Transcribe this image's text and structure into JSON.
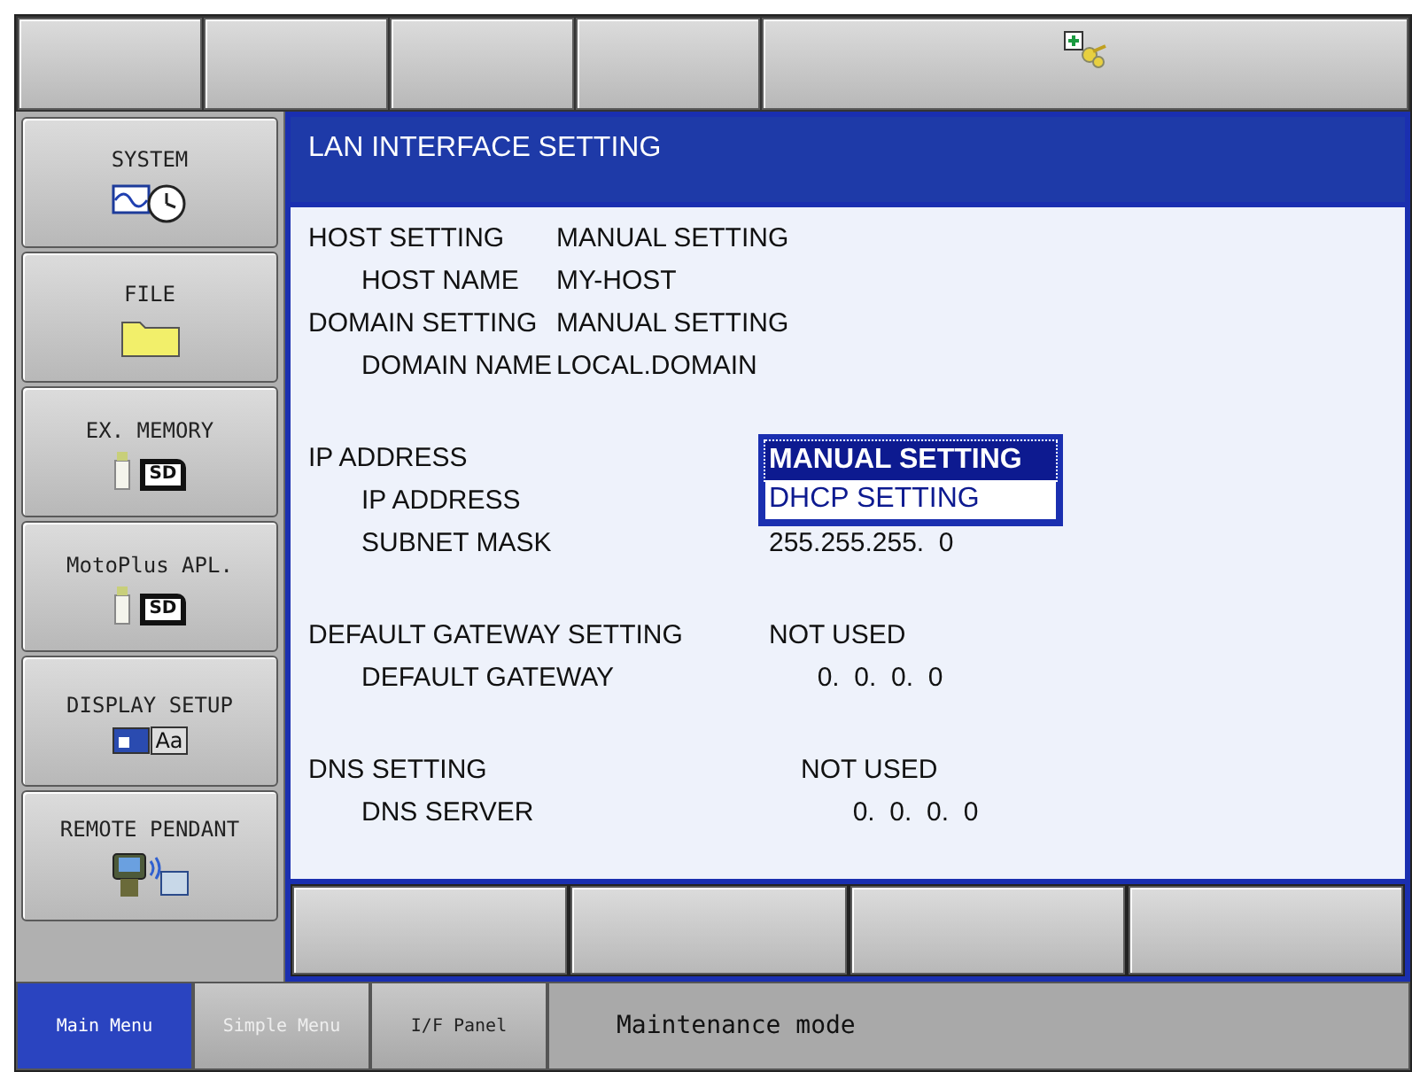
{
  "side_menu": [
    {
      "label": "SYSTEM",
      "kind": "system"
    },
    {
      "label": "FILE",
      "kind": "file"
    },
    {
      "label": "EX. MEMORY",
      "kind": "memory",
      "icon_text": "SD"
    },
    {
      "label": "MotoPlus APL.",
      "kind": "memory",
      "icon_text": "SD"
    },
    {
      "label": "DISPLAY SETUP",
      "kind": "display",
      "icon_text": "Aa"
    },
    {
      "label": "REMOTE PENDANT",
      "kind": "pendant"
    }
  ],
  "panel": {
    "title": "LAN INTERFACE SETTING",
    "sections": [
      {
        "items": [
          {
            "label": "HOST SETTING",
            "value": "MANUAL SETTING",
            "children": [
              {
                "label": "HOST NAME",
                "value": "MY-HOST"
              }
            ]
          },
          {
            "label": "DOMAIN SETTING",
            "value": "MANUAL SETTING",
            "children": [
              {
                "label": "DOMAIN NAME",
                "value": "LOCAL.DOMAIN"
              }
            ]
          }
        ]
      },
      {
        "items": [
          {
            "label": "IP ADDRESS",
            "options": [
              {
                "label": "MANUAL SETTING",
                "selected": true
              },
              {
                "label": "DHCP SETTING",
                "selected": false
              }
            ],
            "children": [
              {
                "label": "IP ADDRESS"
              },
              {
                "label": "SUBNET MASK",
                "value": "255.255.255.  0"
              }
            ]
          }
        ]
      },
      {
        "items": [
          {
            "label": "DEFAULT GATEWAY SETTING",
            "value": "NOT USED",
            "children": [
              {
                "label": "DEFAULT GATEWAY",
                "value": "  0.  0.  0.  0"
              }
            ]
          }
        ]
      },
      {
        "items": [
          {
            "label": "DNS SETTING",
            "value": "NOT USED",
            "children": [
              {
                "label": "DNS SERVER",
                "value": "  0.  0.  0.  0"
              }
            ]
          }
        ]
      }
    ]
  },
  "status_bar": {
    "tabs": [
      {
        "label": "Main Menu",
        "selected": true,
        "disabled": false
      },
      {
        "label": "Simple Menu",
        "selected": false,
        "disabled": true
      },
      {
        "label": "I/F Panel",
        "selected": false,
        "disabled": false
      }
    ],
    "message": "Maintenance mode"
  }
}
